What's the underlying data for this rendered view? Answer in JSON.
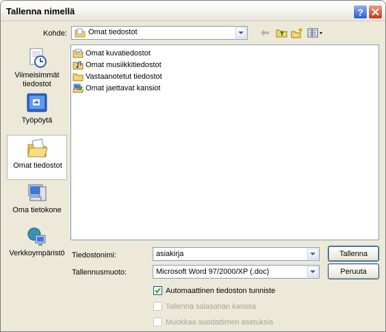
{
  "window": {
    "title": "Tallenna nimellä"
  },
  "toolbar": {
    "location_label": "Kohde:",
    "location_value": "Omat tiedostot",
    "icons": [
      "back-arrow-icon",
      "up-folder-icon",
      "new-folder-icon",
      "view-menu-icon"
    ]
  },
  "places": [
    {
      "label1": "Viimeisimmät",
      "label2": "tiedostot",
      "icon": "recent-documents-icon"
    },
    {
      "label1": "Työpöytä",
      "label2": "",
      "icon": "desktop-icon"
    },
    {
      "label1": "Omat tiedostot",
      "label2": "",
      "icon": "my-documents-icon",
      "selected": true
    },
    {
      "label1": "Oma tietokone",
      "label2": "",
      "icon": "my-computer-icon"
    },
    {
      "label1": "Verkkoympäristö",
      "label2": "",
      "icon": "network-places-icon"
    }
  ],
  "files": [
    {
      "name": "Omat kuvatiedostot",
      "icon": "my-pictures-folder-icon"
    },
    {
      "name": "Omat musiikkitiedostot",
      "icon": "my-music-folder-icon"
    },
    {
      "name": "Vastaanotetut tiedostot",
      "icon": "folder-icon"
    },
    {
      "name": "Omat jaettavat kansiot",
      "icon": "shared-folders-icon"
    }
  ],
  "form": {
    "filename_label": "Tiedostonimi:",
    "filename_value": "asiakirja",
    "filetype_label": "Tallennusmuoto:",
    "filetype_value": "Microsoft Word 97/2000/XP (.doc)"
  },
  "buttons": {
    "save": "Tallenna",
    "cancel": "Peruuta"
  },
  "options": [
    {
      "label": "Automaattinen tiedoston tunniste",
      "checked": true,
      "enabled": true
    },
    {
      "label": "Tallenna salasanan kanssa",
      "checked": false,
      "enabled": false
    },
    {
      "label": "Muokkaa suodattimen asetuksia",
      "checked": false,
      "enabled": false
    }
  ],
  "colors": {
    "dialog_bg": "#ece9d8",
    "field_border": "#7f9db9",
    "close_red": "#c4381b",
    "help_blue": "#2b5fd1"
  }
}
